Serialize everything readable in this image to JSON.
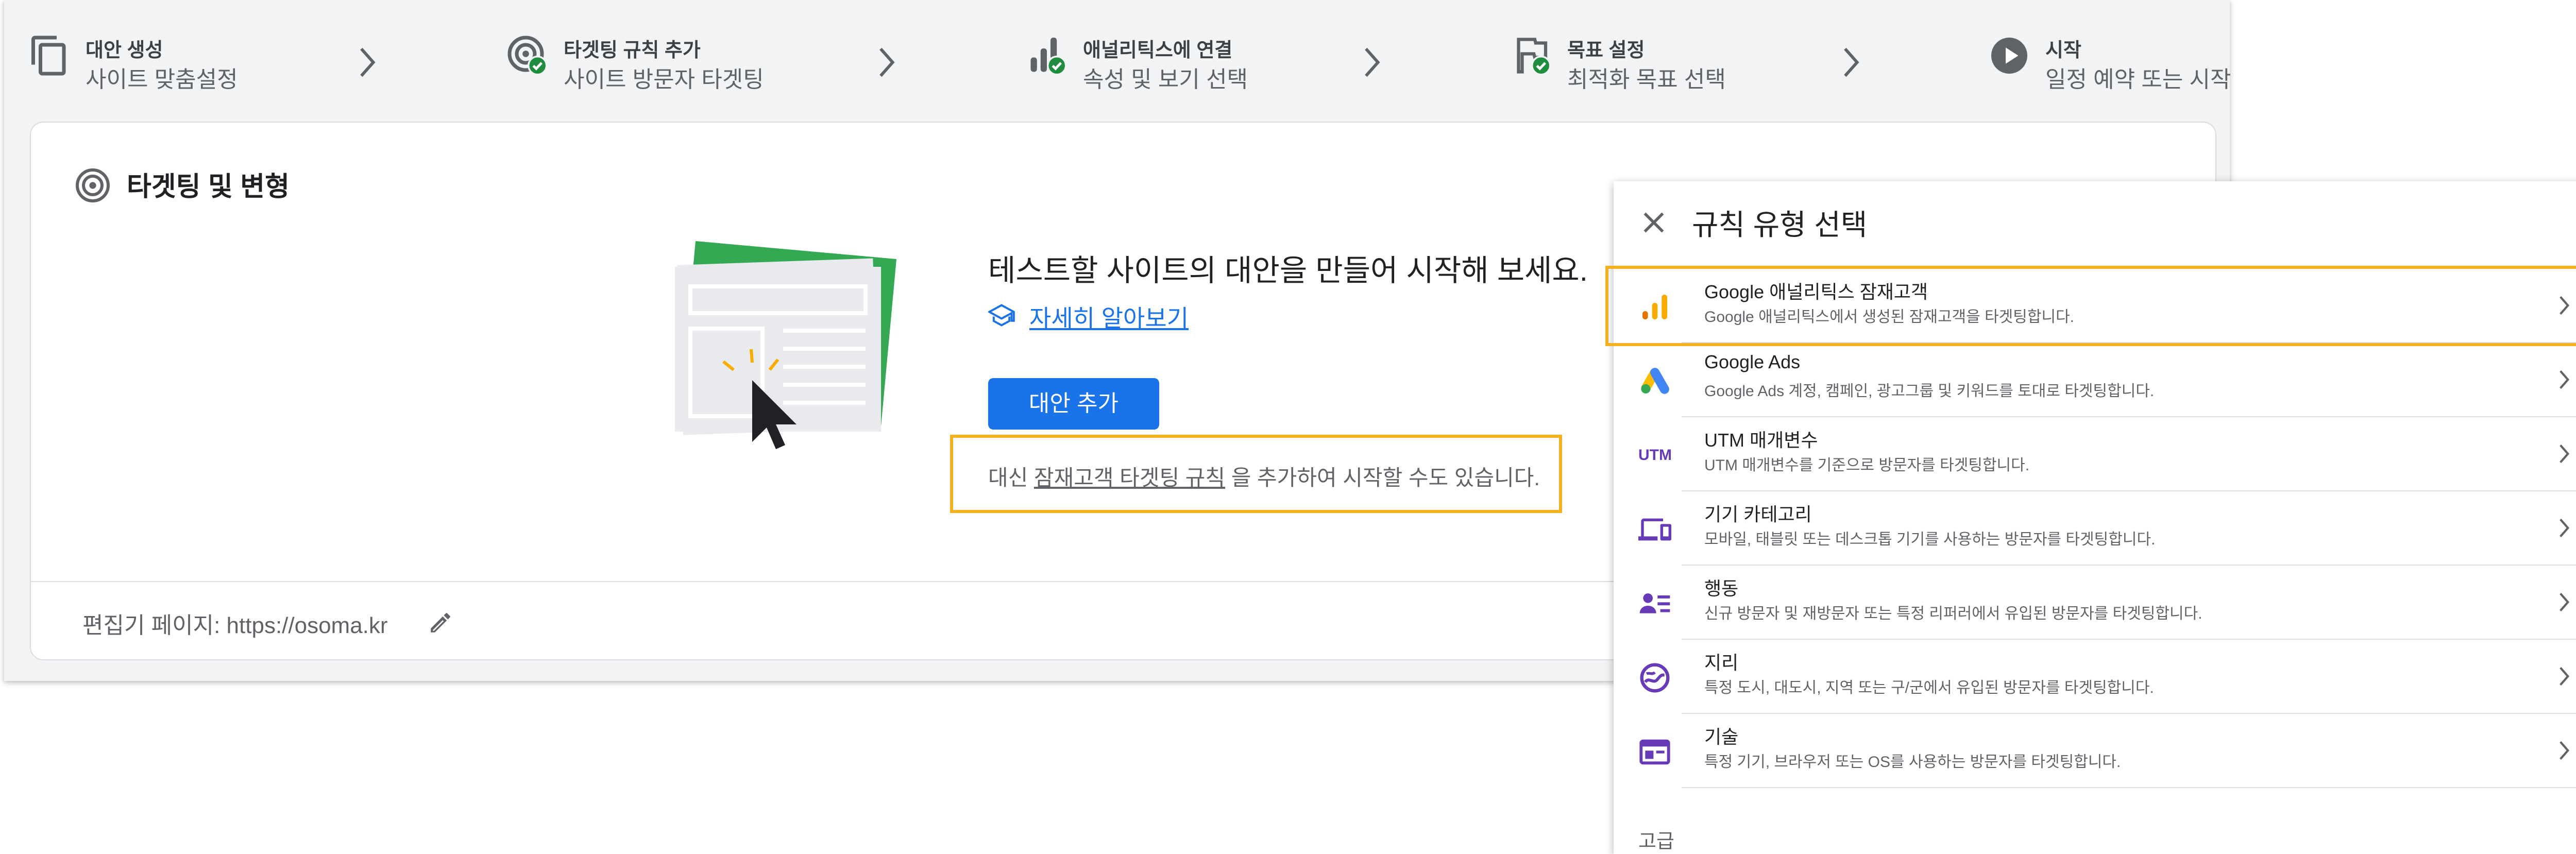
{
  "stepper": {
    "steps": [
      {
        "title": "대안 생성",
        "subtitle": "사이트 맞춤설정",
        "icon": "copy-icon"
      },
      {
        "title": "타겟팅 규칙 추가",
        "subtitle": "사이트 방문자 타겟팅",
        "icon": "target-check-icon"
      },
      {
        "title": "애널리틱스에 연결",
        "subtitle": "속성 및 보기 선택",
        "icon": "analytics-check-icon"
      },
      {
        "title": "목표 설정",
        "subtitle": "최적화 목표 선택",
        "icon": "flag-check-icon"
      },
      {
        "title": "시작",
        "subtitle": "일정 예약 또는 시작",
        "icon": "play-circle-icon"
      }
    ]
  },
  "card": {
    "title": "타겟팅 및 변형",
    "headline": "테스트할 사이트의 대안을 만들어 시작해 보세요.",
    "learn_more": "자세히 알아보기",
    "add_button": "대안 추가",
    "alt_prefix": "대신 ",
    "alt_link": "잠재고객 타겟팅 규칙",
    "alt_suffix": " 을 추가하여 시작할 수도 있습니다.",
    "editor_label": "편집기 페이지: https://osoma.kr"
  },
  "panel": {
    "title": "규칙 유형 선택",
    "rules": [
      {
        "title": "Google 애널리틱스 잠재고객",
        "desc": "Google 애널리틱스에서 생성된 잠재고객을 타겟팅합니다.",
        "icon": "analytics-icon"
      },
      {
        "title": "Google Ads",
        "desc": "Google Ads 계정, 캠페인, 광고그룹 및 키워드를 토대로 타겟팅합니다.",
        "icon": "google-ads-icon"
      },
      {
        "title": "UTM 매개변수",
        "desc": "UTM 매개변수를 기준으로 방문자를 타겟팅합니다.",
        "icon": "utm-icon",
        "icon_text": "UTM"
      },
      {
        "title": "기기 카테고리",
        "desc": "모바일, 태블릿 또는 데스크톱 기기를 사용하는 방문자를 타겟팅합니다.",
        "icon": "devices-icon"
      },
      {
        "title": "행동",
        "desc": "신규 방문자 및 재방문자 또는 특정 리퍼러에서 유입된 방문자를 타겟팅합니다.",
        "icon": "behavior-icon"
      },
      {
        "title": "지리",
        "desc": "특정 도시, 대도시, 지역 또는 구/군에서 유입된 방문자를 타겟팅합니다.",
        "icon": "geo-icon"
      },
      {
        "title": "기술",
        "desc": "특정 기기, 브라우저 또는 OS를 사용하는 방문자를 타겟팅합니다.",
        "icon": "technology-icon"
      }
    ],
    "footer": "고급"
  },
  "colors": {
    "primary": "#1a73e8",
    "success": "#1e8e3e",
    "highlight": "#f5b01f",
    "purple": "#673ab7",
    "analytics_orange": "#f9ab00"
  }
}
